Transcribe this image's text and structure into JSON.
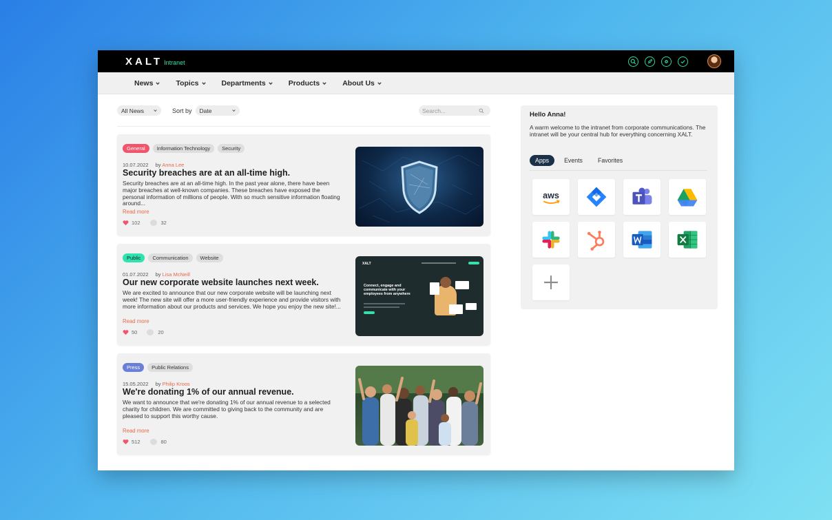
{
  "brand": {
    "name": "XALT",
    "sub": "Intranet"
  },
  "top_icons": [
    "search-icon",
    "rocket-icon",
    "settings-icon",
    "check-icon"
  ],
  "nav": [
    {
      "label": "News"
    },
    {
      "label": "Topics"
    },
    {
      "label": "Departments"
    },
    {
      "label": "Products"
    },
    {
      "label": "About Us"
    }
  ],
  "filters": {
    "category": "All News",
    "sort_label": "Sort by",
    "sort_value": "Date",
    "search_placeholder": "Search..."
  },
  "articles": [
    {
      "tags": [
        {
          "label": "General",
          "color": "#f0556b",
          "text_color": "#ffffff"
        },
        {
          "label": "Information Technology"
        },
        {
          "label": "Security"
        }
      ],
      "date": "10.07.2022",
      "by": "by",
      "author": "Anna Lee",
      "title": "Security breaches are at an all-time high.",
      "excerpt": "Security breaches are at an all-time high. In the past year alone, there have been major breaches at well-known companies. These breaches have exposed the personal information of millions of people. With so much sensitive information floating around...",
      "read_more": "Read more",
      "likes": "102",
      "comments": "32"
    },
    {
      "tags": [
        {
          "label": "Public",
          "color": "#2fe3b0",
          "text_color": "#1d1d1d"
        },
        {
          "label": "Communication"
        },
        {
          "label": "Website"
        }
      ],
      "date": "01.07.2022",
      "by": "by",
      "author": "Lisa McNeill",
      "title": "Our new corporate website launches next week.",
      "excerpt": "We are excited to announce that our new corporate website will be launching next week! The new site will offer a more user-friendly experience and provide visitors with more information about our products and services. We hope you enjoy the new site!...",
      "read_more": "Read more",
      "likes": "50",
      "comments": "20",
      "thumb_text": {
        "brand": "XALT",
        "headline": "Connect, engage and communicate with your employees from anywhere"
      }
    },
    {
      "tags": [
        {
          "label": "Press",
          "color": "#6a7fd6",
          "text_color": "#ffffff"
        },
        {
          "label": "Public Relations"
        }
      ],
      "date": "15.05.2022",
      "by": "by",
      "author": "Philip Kroos",
      "title": "We're donating 1% of our annual revenue.",
      "excerpt": "We want to announce that we're donating 1% of our annual revenue to a selected charity for children. We are committed to giving back to the community and are pleased to support this worthy cause.",
      "read_more": "Read more",
      "likes": "512",
      "comments": "80"
    }
  ],
  "sidebar": {
    "greeting": "Hello Anna!",
    "welcome": "A warm welcome to the intranet from corporate communications. The intranet will be your central hub for everything concerning XALT.",
    "tabs": [
      {
        "label": "Apps",
        "active": true
      },
      {
        "label": "Events",
        "active": false
      },
      {
        "label": "Favorites",
        "active": false
      }
    ],
    "apps": [
      {
        "icon": "aws-icon",
        "label": "aws"
      },
      {
        "icon": "jira-icon"
      },
      {
        "icon": "teams-icon"
      },
      {
        "icon": "google-drive-icon"
      },
      {
        "icon": "slack-icon"
      },
      {
        "icon": "hubspot-icon"
      },
      {
        "icon": "word-icon"
      },
      {
        "icon": "excel-icon"
      },
      {
        "icon": "add-app-icon"
      }
    ]
  }
}
